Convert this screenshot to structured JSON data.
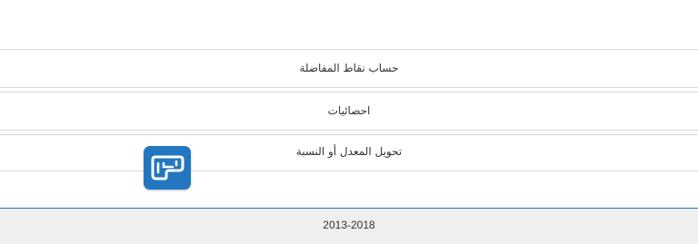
{
  "menu": {
    "items": [
      {
        "label": "حساب نقاط المفاضلة"
      },
      {
        "label": "احصائيات"
      },
      {
        "label": "تحويل المعدل أو النسبة"
      }
    ]
  },
  "logo": {
    "icon": "site-logo-icon",
    "color": "#2277c0"
  },
  "footer": {
    "years": "2013-2018"
  },
  "colors": {
    "accent_line": "#2e6ea8",
    "footer_bg": "#efefef",
    "separator": "#d8d8d8"
  }
}
